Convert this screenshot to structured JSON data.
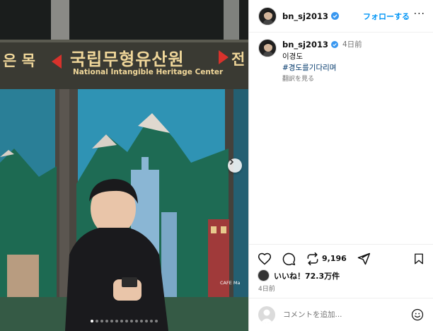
{
  "photo": {
    "sign_korean": "국립무형유산원",
    "sign_left": "은 목",
    "sign_right": "전",
    "sign_english": "National Intangible Heritage Center",
    "cafe_sign": "CAFE Ma",
    "slide_count": 14,
    "active_slide": 0
  },
  "header": {
    "username": "bn_sj2013",
    "follow_label": "フォローする",
    "more_label": "···"
  },
  "caption": {
    "username": "bn_sj2013",
    "time": "4日前",
    "text": "이경도",
    "hashtag": "#경도를기다리며",
    "translate": "翻訳を見る"
  },
  "actions": {
    "repost_count": "9,196"
  },
  "likes": {
    "label": "いいね！72.3万件"
  },
  "post_date": "4日前",
  "comment": {
    "placeholder": "コメントを追加..."
  },
  "colors": {
    "accent": "#0095f6",
    "verified": "#3897f0",
    "hashtag": "#00376b"
  }
}
